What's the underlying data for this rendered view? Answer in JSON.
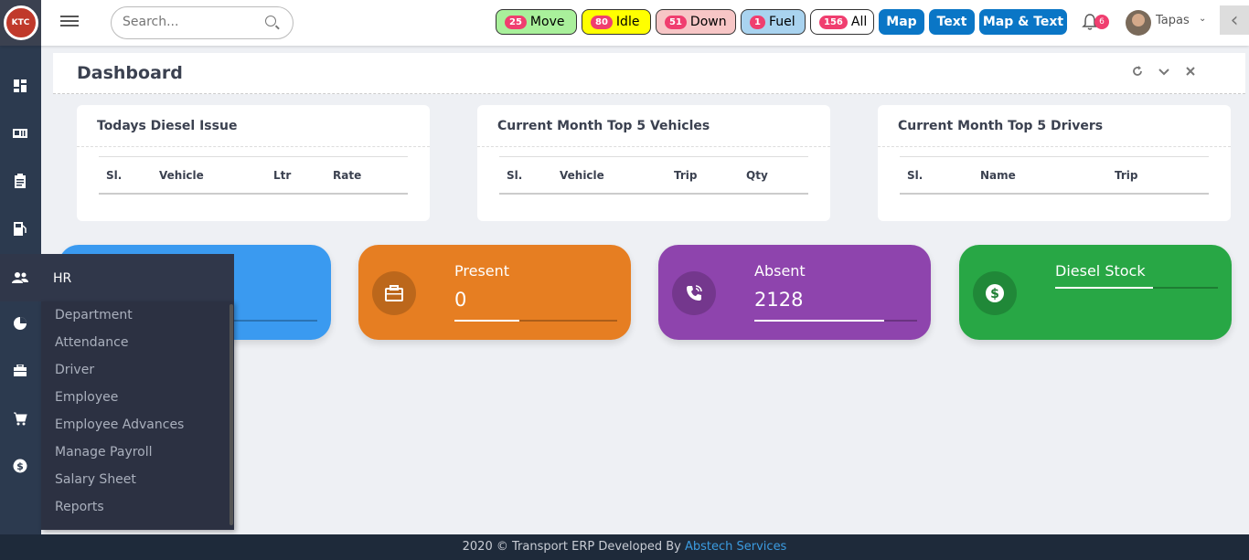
{
  "header": {
    "logo_text": "KTC",
    "search_placeholder": "Search...",
    "status_pills": [
      {
        "count": "25",
        "label": "Move",
        "bg": "#a9f09b"
      },
      {
        "count": "80",
        "label": "Idle",
        "bg": "#ffff00"
      },
      {
        "count": "51",
        "label": "Down",
        "bg": "#f7c6c6"
      },
      {
        "count": "1",
        "label": "Fuel",
        "bg": "#a9d3ef"
      },
      {
        "count": "156",
        "label": "All",
        "bg": "#ffffff"
      }
    ],
    "view_buttons": [
      "Map",
      "Text",
      "Map & Text"
    ],
    "notification_count": "6",
    "user_name": "Tapas",
    "user_caret": "⌄",
    "collapse_glyph": "‹",
    "bell_icon": "bell-icon"
  },
  "sidebar": {
    "icons": [
      "dashboard-icon",
      "id-card-icon",
      "clipboard-icon",
      "fuel-pump-icon",
      "users-icon",
      "pie-chart-icon",
      "briefcase-icon",
      "cart-icon",
      "dollar-icon"
    ]
  },
  "flyout": {
    "title": "HR",
    "items": [
      "Department",
      "Attendance",
      "Driver",
      "Employee",
      "Employee Advances",
      "Manage Payroll",
      "Salary Sheet",
      "Reports"
    ]
  },
  "page": {
    "title": "Dashboard",
    "controls": [
      "refresh-icon",
      "chevron-down-icon",
      "close-icon"
    ]
  },
  "cards": [
    {
      "title": "Todays Diesel Issue",
      "columns": [
        "Sl.",
        "Vehicle",
        "Ltr",
        "Rate"
      ]
    },
    {
      "title": "Current Month Top 5 Vehicles",
      "columns": [
        "Sl.",
        "Vehicle",
        "Trip",
        "Qty"
      ]
    },
    {
      "title": "Current Month Top 5 Drivers",
      "columns": [
        "Sl.",
        "Name",
        "Trip"
      ]
    }
  ],
  "stats": [
    {
      "label": "",
      "value": "",
      "color": "#3a9af0",
      "icon": "user-icon",
      "progress": 0.4
    },
    {
      "label": "Present",
      "value": "0",
      "color": "#e67e22",
      "icon": "briefcase-icon",
      "progress": 0.4
    },
    {
      "label": "Absent",
      "value": "2128",
      "color": "#8e44ad",
      "icon": "phone-icon",
      "progress": 0.8
    },
    {
      "label": "Diesel Stock",
      "value": "",
      "color": "#28a745",
      "icon": "dollar-icon",
      "progress": 0.6
    }
  ],
  "footer": {
    "text": "2020 © Transport ERP Developed By ",
    "brand": "Abstech Services"
  }
}
